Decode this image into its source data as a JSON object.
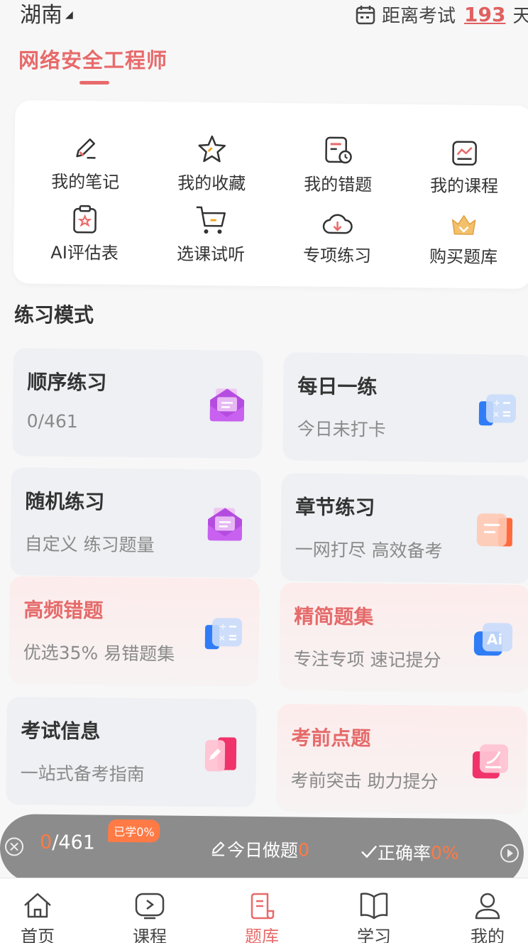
{
  "header": {
    "region": "湖南",
    "countdown_label": "距离考试",
    "countdown_days": "193",
    "countdown_unit": "天",
    "subject": "网络安全工程师"
  },
  "quick_actions": [
    {
      "label": "我的笔记",
      "icon": "note-edit-icon"
    },
    {
      "label": "我的收藏",
      "icon": "star-icon"
    },
    {
      "label": "我的错题",
      "icon": "wrong-questions-icon"
    },
    {
      "label": "我的课程",
      "icon": "course-chart-icon"
    },
    {
      "label": "AI评估表",
      "icon": "clipboard-star-icon"
    },
    {
      "label": "选课试听",
      "icon": "cart-icon"
    },
    {
      "label": "专项练习",
      "icon": "cloud-download-icon"
    },
    {
      "label": "购买题库",
      "icon": "crown-icon"
    }
  ],
  "section_title": "练习模式",
  "modes": [
    {
      "title": "顺序练习",
      "sub": "0/461",
      "icon": "envelope-icon"
    },
    {
      "title": "每日一练",
      "sub": "今日未打卡",
      "icon": "calculator-icon"
    },
    {
      "title": "随机练习",
      "sub": "自定义 练习题量",
      "icon": "envelope-icon"
    },
    {
      "title": "章节练习",
      "sub": "一网打尽 高效备考",
      "icon": "chapter-icon"
    },
    {
      "title": "高频错题",
      "sub": "优选35% 易错题集",
      "icon": "calculator-icon"
    },
    {
      "title": "精简题集",
      "sub": "专注专项 速记提分",
      "icon": "ai-icon"
    },
    {
      "title": "考试信息",
      "sub": "一站式备考指南",
      "icon": "book-edit-icon"
    },
    {
      "title": "考前点题",
      "sub": "考前突击 助力提分",
      "icon": "paper-icon"
    }
  ],
  "progress": {
    "done": "0",
    "total": "/461",
    "badge": "已学0%",
    "today_label": "今日做题",
    "today_value": "0",
    "accuracy_label": "正确率",
    "accuracy_value": "0%"
  },
  "tabs": [
    {
      "label": "首页",
      "icon": "home-icon"
    },
    {
      "label": "课程",
      "icon": "play-icon"
    },
    {
      "label": "题库",
      "icon": "question-bank-icon"
    },
    {
      "label": "学习",
      "icon": "book-icon"
    },
    {
      "label": "我的",
      "icon": "user-icon"
    }
  ],
  "colors": {
    "accent": "#e86a6a",
    "orange": "#ff7a45",
    "purple": "#b85ce0",
    "blue": "#2f7cf6"
  }
}
